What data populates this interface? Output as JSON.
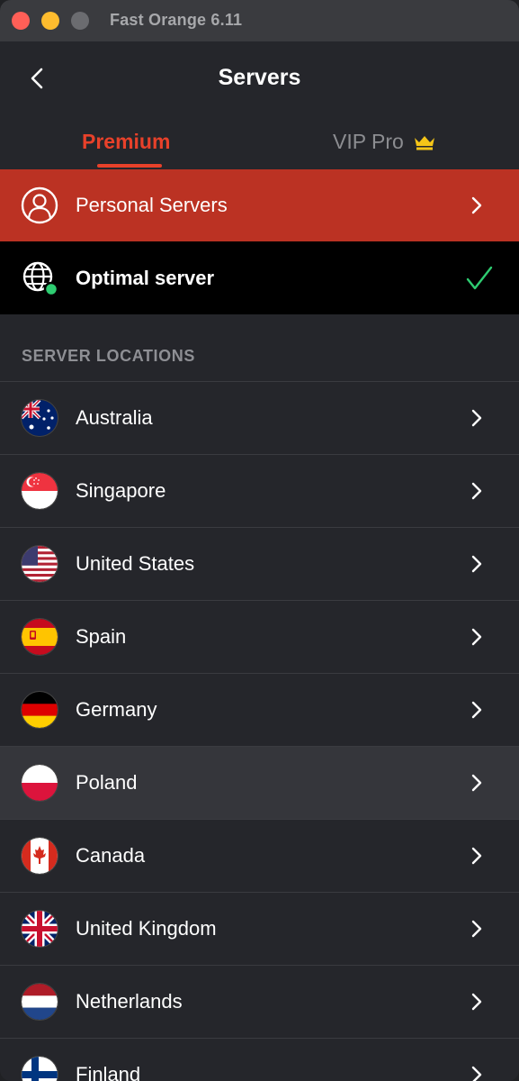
{
  "window": {
    "title": "Fast Orange 6.11"
  },
  "header": {
    "title": "Servers"
  },
  "tabs": [
    {
      "label": "Premium",
      "active": true
    },
    {
      "label": "VIP Pro",
      "active": false,
      "icon": "crown-icon"
    }
  ],
  "personal_servers": {
    "label": "Personal Servers"
  },
  "optimal_server": {
    "label": "Optimal server",
    "selected": true
  },
  "section": {
    "label": "SERVER LOCATIONS"
  },
  "locations": [
    {
      "label": "Australia",
      "flag": "australia"
    },
    {
      "label": "Singapore",
      "flag": "singapore"
    },
    {
      "label": "United States",
      "flag": "united-states"
    },
    {
      "label": "Spain",
      "flag": "spain"
    },
    {
      "label": "Germany",
      "flag": "germany"
    },
    {
      "label": "Poland",
      "flag": "poland",
      "highlighted": true
    },
    {
      "label": "Canada",
      "flag": "canada"
    },
    {
      "label": "United Kingdom",
      "flag": "united-kingdom"
    },
    {
      "label": "Netherlands",
      "flag": "netherlands"
    },
    {
      "label": "Finland",
      "flag": "finland"
    }
  ],
  "colors": {
    "accent": "#e8412a",
    "personal_bg": "#bb3223",
    "check": "#2ecc71",
    "background": "#25262b"
  }
}
